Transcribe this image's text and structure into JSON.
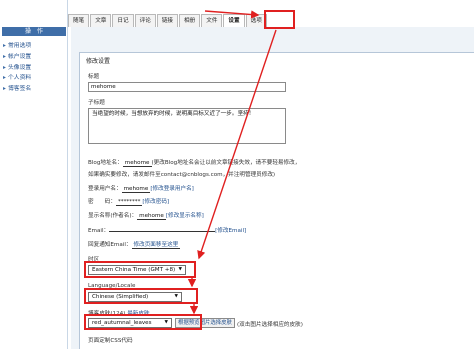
{
  "sidebar": {
    "header": "操　作",
    "items": [
      {
        "label": "常用选项"
      },
      {
        "label": "帐户设置"
      },
      {
        "label": "头像设置"
      },
      {
        "label": "个人资料"
      },
      {
        "label": "博客签名"
      }
    ]
  },
  "tabs": [
    {
      "label": "随笔",
      "active": false
    },
    {
      "label": "文章",
      "active": false
    },
    {
      "label": "日记",
      "active": false
    },
    {
      "label": "评论",
      "active": false
    },
    {
      "label": "链接",
      "active": false
    },
    {
      "label": "相册",
      "active": false
    },
    {
      "label": "文件",
      "active": false
    },
    {
      "label": "设置",
      "active": true
    },
    {
      "label": "选项",
      "active": false
    }
  ],
  "panel": {
    "title": "修改设置",
    "title_label": "标题",
    "title_value": "mehome",
    "subtitle_label": "子标题",
    "subtitle_value": "当绝望的时候，当想放弃的时候，说明离目标又近了一步。坚持！",
    "blog_addr_label": "Blog地址名：",
    "blog_addr_value": "mehome",
    "blog_addr_note": "(更改Blog地址名会让以前文章链接失效，请不要轻易修改，",
    "blog_addr_note2": "如果确实要修改，请发邮件至contact@cnblogs.com，并注明管理员修改)",
    "login_label": "登录用户名：",
    "login_value": "mehome",
    "login_link": "[修改登录用户名]",
    "password_label": "密　　码：",
    "password_value": "********",
    "password_link": "[修改密码]",
    "author_label": "显示名称(作者名)：",
    "author_value": "mehome",
    "author_link": "[修改显示名称]",
    "email_label": "Email：",
    "email_link": "[修改Email]",
    "notify_label": "回复通知Email：",
    "notify_value": "修改页面移至这里",
    "timezone_label": "时区",
    "timezone_value": "Eastern China Time (GMT +8)",
    "language_label": "Language/Locale",
    "language_value": "Chinese (Simplified)",
    "skin_label": "博客皮肤(124)",
    "skin_link": "最新皮肤",
    "skin_value": "red_autumnal_leaves",
    "skin_preview": "根据预览图片选择皮肤",
    "skin_note": "(双击图片选择相应的皮肤)",
    "css_label": "页面定制CSS代码"
  },
  "annotations": {
    "color": "#e02020"
  },
  "colors": {
    "accent": "#3f6ea8",
    "link": "#1f4e8c",
    "panel_bg": "#eef3f8"
  }
}
